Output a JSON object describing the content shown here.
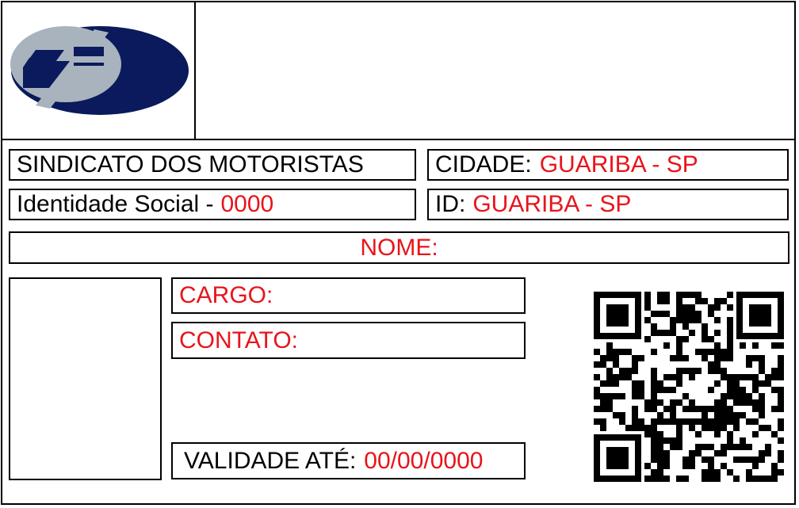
{
  "header": {
    "logo_icon": "union-logo-emblem",
    "colors": {
      "navy": "#0a1a5c",
      "gray": "#a9b3bd",
      "accent": "#e8141b"
    }
  },
  "fields": {
    "union_name": "SINDICATO DOS MOTORISTAS",
    "city_label": "CIDADE:",
    "city_value": "GUARIBA - SP",
    "social_id_label": "Identidade Social -",
    "social_id_value": "0000",
    "id_label": "ID:",
    "id_value": "GUARIBA - SP",
    "name_label": "NOME:",
    "role_label": "CARGO:",
    "contact_label": "CONTATO:",
    "validity_label": "VALIDADE ATÉ:",
    "validity_value": "00/00/0000"
  },
  "qr": {
    "icon": "qr-code-icon"
  }
}
